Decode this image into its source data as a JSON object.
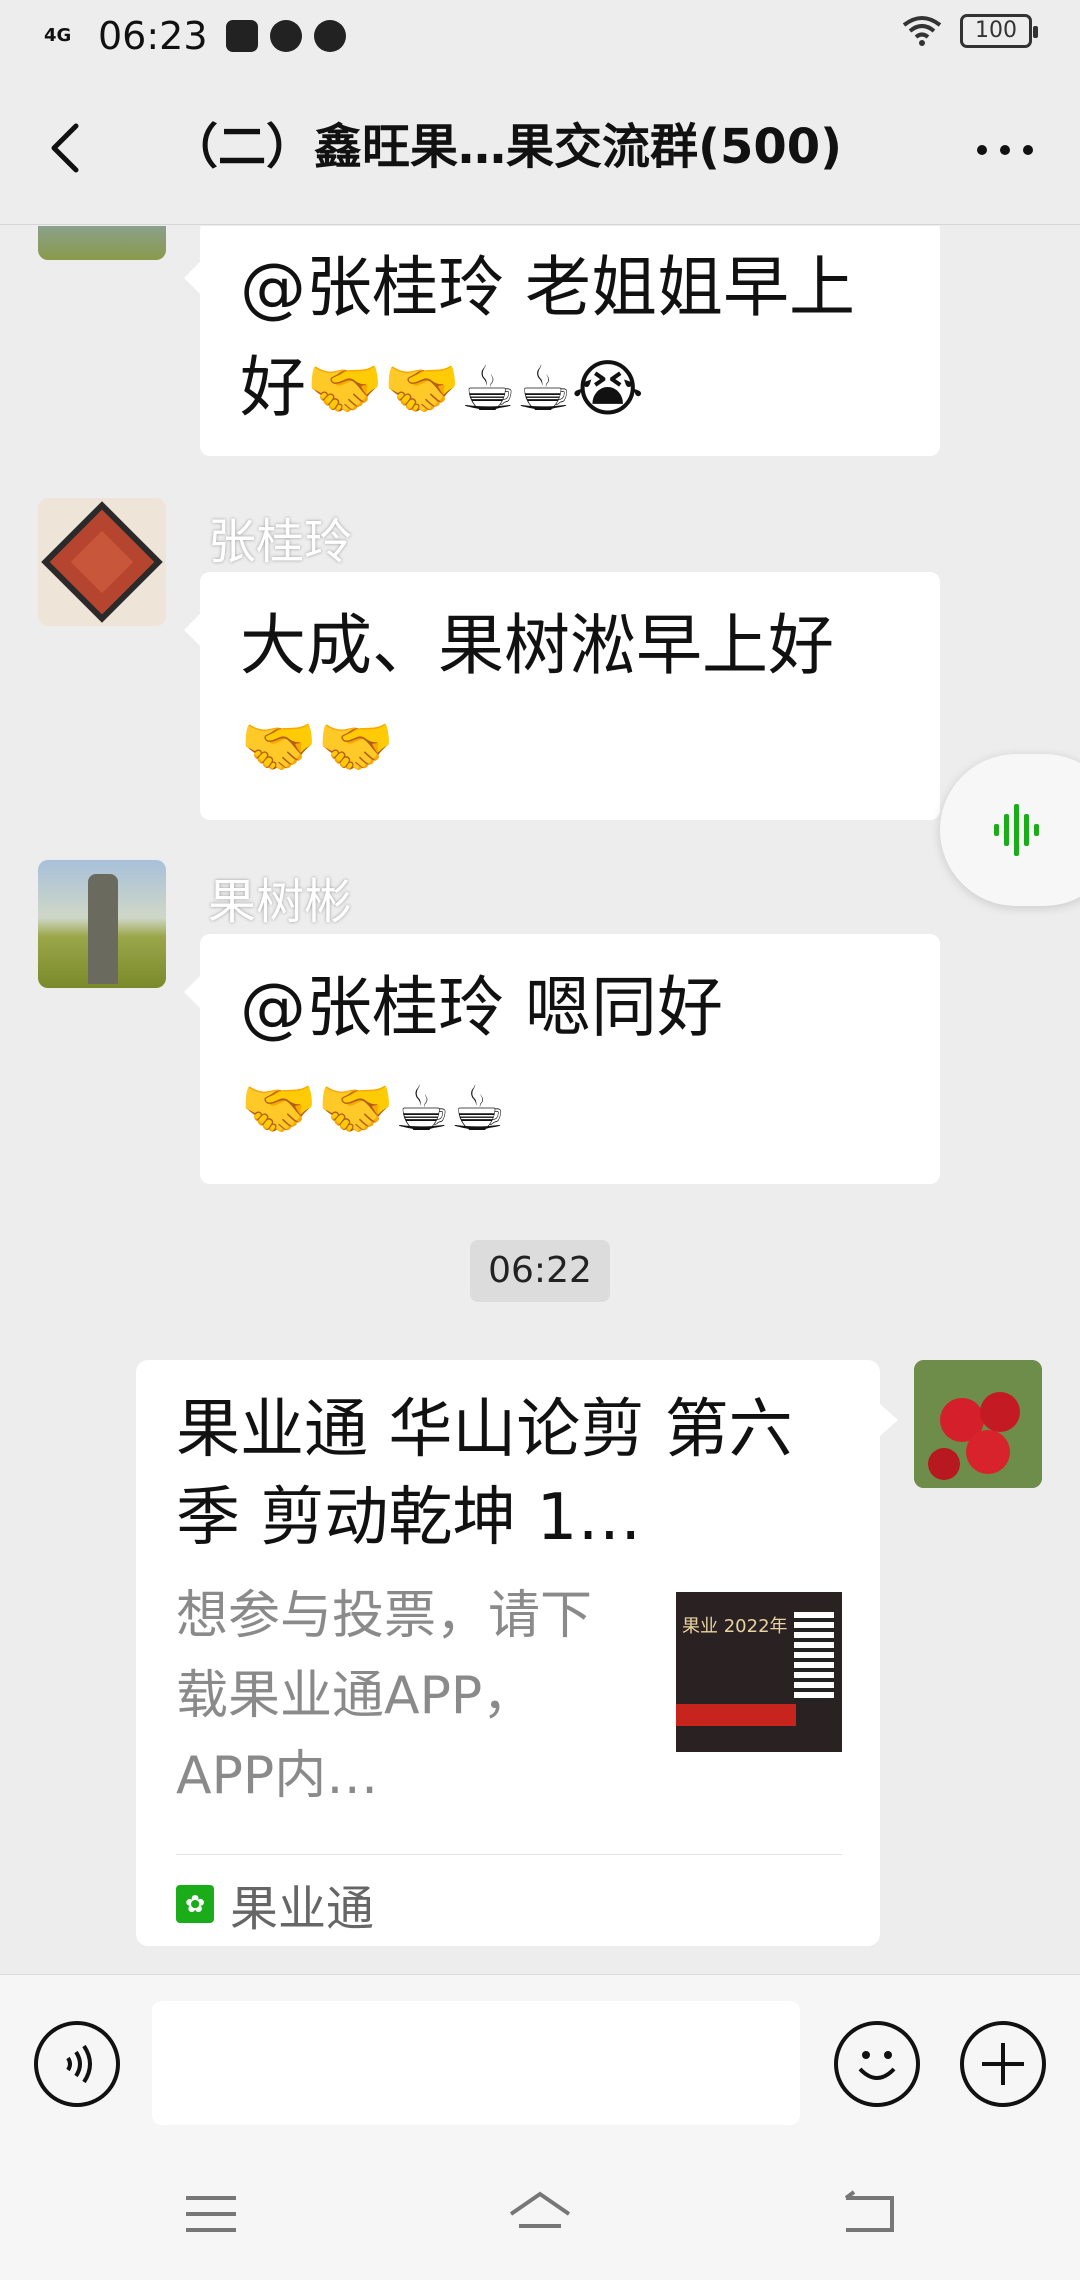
{
  "status_bar": {
    "network": "4G",
    "time": "06:23",
    "battery": "100"
  },
  "header": {
    "title": "（二）鑫旺果…果交流群(500)"
  },
  "messages": [
    {
      "text": "@张桂玲  老姐姐早上好",
      "emoji": "🤝🤝☕☕😭"
    },
    {
      "sender": "张桂玲",
      "text": "大成、果树淞早上好",
      "emoji": "🤝🤝"
    },
    {
      "sender": "果树彬",
      "text": "@张桂玲  嗯同好",
      "emoji": "🤝🤝☕☕"
    }
  ],
  "timestamp": "06:22",
  "shared_card": {
    "title": "果业通 华山论剪 第六季 剪动乾坤 1…",
    "description": "想参与投票，请下载果业通APP，APP内…",
    "thumbnail_text": "果业 2022年",
    "source": "果业通"
  },
  "colors": {
    "accent_green": "#1aad19",
    "bubble": "#ffffff",
    "background": "#ededed"
  },
  "icons": [
    "back-icon",
    "more-icon",
    "voice-input-icon",
    "emoji-icon",
    "plus-icon",
    "menu-icon",
    "home-icon",
    "return-icon",
    "sound-wave-icon"
  ]
}
